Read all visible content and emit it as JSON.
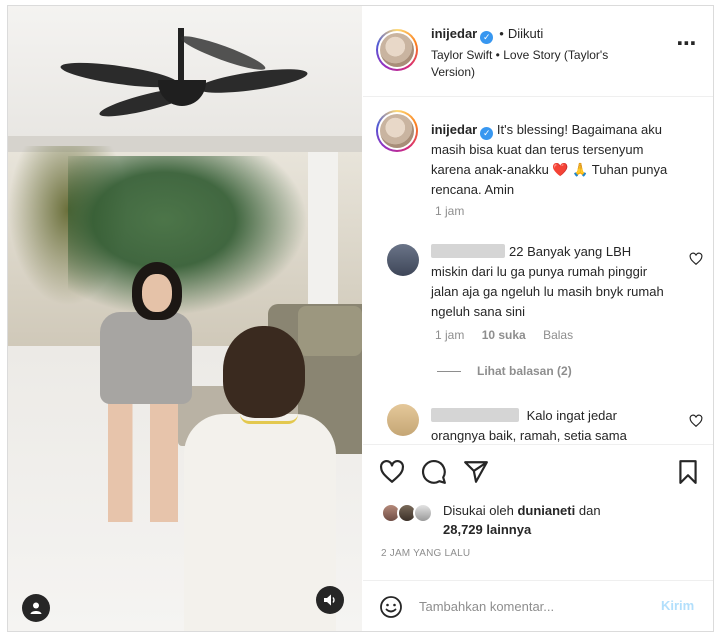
{
  "post": {
    "username": "inijedar",
    "verified_mark": "✓",
    "follow_separator": "•",
    "follow_status": "Diikuti",
    "music": "Taylor Swift • Love Story (Taylor's Version)",
    "more_icon": "⋯"
  },
  "caption": {
    "username": "inijedar",
    "text": "It's blessing! Bagaimana aku masih bisa kuat dan terus tersenyum karena anak-anakku ❤️ 🙏 Tuhan punya rencana. Amin",
    "time": "1 jam"
  },
  "comments": [
    {
      "username_partial": "22",
      "text": "Banyak yang LBH miskin dari lu ga punya rumah pinggir jalan aja ga ngeluh lu masih bnyk rumah ngeluh sana sini",
      "time": "1 jam",
      "likes": "10 suka",
      "reply_label": "Balas",
      "view_replies": "Lihat balasan (2)"
    },
    {
      "username_partial": "",
      "text": "Kalo ingat jedar orangnya baik, ramah, setia sama"
    }
  ],
  "likes": {
    "prefix": "Disukai oleh",
    "user": "dunianeti",
    "joiner": "dan",
    "count": "28,729 lainnya"
  },
  "time_ago": "2 JAM YANG LALU",
  "add_comment": {
    "placeholder": "Tambahkan komentar...",
    "post_label": "Kirim"
  },
  "icons": {
    "like": "heart-icon",
    "comment": "comment-icon",
    "share": "paper-plane-icon",
    "save": "bookmark-icon",
    "emoji": "smiley-icon",
    "tag": "person-tag-icon",
    "sound": "speaker-icon"
  },
  "colors": {
    "verified": "#3897f0",
    "heart_emoji": "#e0245e",
    "post_button_disabled": "#b2dffc",
    "muted_text": "#8e8e8e"
  }
}
